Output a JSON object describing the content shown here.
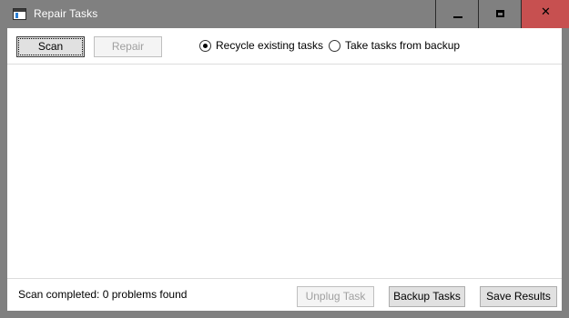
{
  "window": {
    "title": "Repair Tasks",
    "controls": {
      "minimize_icon": "minimize-icon",
      "maximize_icon": "maximize-icon",
      "close_icon": "close-icon",
      "close_glyph": "✕",
      "close_hover_color": "#c75050"
    }
  },
  "toolbar": {
    "scan_label": "Scan",
    "repair_label": "Repair",
    "repair_enabled": false,
    "options": [
      {
        "label": "Recycle existing tasks",
        "selected": true
      },
      {
        "label": "Take tasks from backup",
        "selected": false
      }
    ]
  },
  "results": {
    "items": []
  },
  "status": {
    "message": "Scan completed: 0 problems found",
    "unplug_label": "Unplug Task",
    "unplug_enabled": false,
    "backup_label": "Backup Tasks",
    "save_label": "Save Results"
  }
}
